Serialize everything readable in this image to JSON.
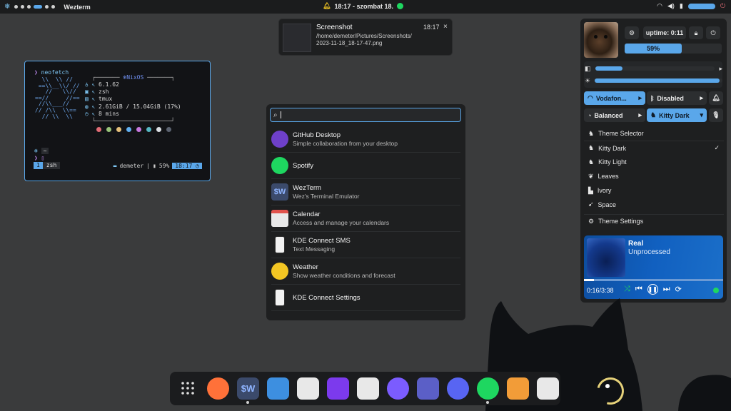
{
  "topbar": {
    "title": "Wezterm",
    "clock": "18:17 - szombat 18.",
    "icons": [
      "nix-icon",
      "bell-icon",
      "spotify-icon",
      "wifi-icon",
      "volume-icon",
      "battery-icon",
      "power-icon"
    ]
  },
  "notification": {
    "title": "Screenshot",
    "time": "18:17",
    "path_line1": "/home/demeter/Pictures/Screenshots/",
    "path_line2": "2023-11-18_18-17-47.png",
    "close": "×"
  },
  "terminal": {
    "command": "neofetch",
    "prompt_symbol": "❯",
    "os": "NixOS",
    "kernel": "6.1.62",
    "shell": "zsh",
    "multiplexer": "tmux",
    "memory": "2.61GiB / 15.04GiB (17%)",
    "uptime": "8 mins",
    "cwd": "~",
    "tab_number": "1",
    "tab_name": "zsh",
    "status_user": "demeter",
    "status_battery": "59%",
    "status_time": "18:17",
    "palette": [
      "#e06c75",
      "#98c379",
      "#e5c07b",
      "#61afef",
      "#c678dd",
      "#56b6c2",
      "#dcdfe4",
      "#5c6370"
    ]
  },
  "launcher": {
    "search_value": "",
    "results": [
      {
        "name": "GitHub Desktop",
        "desc": "Simple collaboration from your desktop",
        "icon": "github-icon",
        "color": "#6e40c9"
      },
      {
        "name": "Spotify",
        "desc": "",
        "icon": "spotify-icon",
        "color": "#1ed760"
      },
      {
        "name": "WezTerm",
        "desc": "Wez's Terminal Emulator",
        "icon": "wezterm-icon",
        "color": "#3b4a6b"
      },
      {
        "name": "Calendar",
        "desc": "Access and manage your calendars",
        "icon": "calendar-icon",
        "color": "#e8e8e8"
      },
      {
        "name": "KDE Connect SMS",
        "desc": "Text Messaging",
        "icon": "kdeconnect-icon",
        "color": "#f2f2f2"
      },
      {
        "name": "Weather",
        "desc": "Show weather conditions and forecast",
        "icon": "weather-icon",
        "color": "#f3c623"
      },
      {
        "name": "KDE Connect Settings",
        "desc": "",
        "icon": "kdeconnect-icon",
        "color": "#f2f2f2"
      }
    ]
  },
  "panel": {
    "uptime": "uptime: 0:11",
    "battery_percent": "59%",
    "battery_level": 0.59,
    "volume_level": 0.23,
    "brightness_level": 0.98,
    "wifi": "Vodafon...",
    "bluetooth": "Disabled",
    "power_profile": "Balanced",
    "theme": "Kitty Dark",
    "menu_header": "Theme Selector",
    "themes": [
      "Kitty Dark",
      "Kitty Light",
      "Leaves",
      "Ivory",
      "Space"
    ],
    "selected_check": "✓",
    "menu_footer": "Theme Settings"
  },
  "player": {
    "track": "Real",
    "artist": "Unprocessed",
    "time": "0:16/3:38",
    "progress": 0.073
  },
  "dock": {
    "apps": [
      {
        "icon": "app-grid-icon",
        "label": "",
        "color": "#1b1c1e",
        "running": false
      },
      {
        "icon": "firefox-icon",
        "label": "",
        "color": "#ff7139",
        "running": false
      },
      {
        "icon": "wezterm-icon",
        "label": "$W",
        "color": "#3b4a6b",
        "running": true
      },
      {
        "icon": "files-icon",
        "label": "",
        "color": "#3d8fe0",
        "running": false
      },
      {
        "icon": "calendar-icon",
        "label": "",
        "color": "#e8e8e8",
        "running": false
      },
      {
        "icon": "obsidian-icon",
        "label": "",
        "color": "#7c3aed",
        "running": false
      },
      {
        "icon": "downloader-icon",
        "label": "",
        "color": "#e8e8e8",
        "running": false
      },
      {
        "icon": "messenger-icon",
        "label": "",
        "color": "#7b5cff",
        "running": false
      },
      {
        "icon": "teams-icon",
        "label": "",
        "color": "#5b5fc7",
        "running": false
      },
      {
        "icon": "discord-icon",
        "label": "",
        "color": "#5865f2",
        "running": false
      },
      {
        "icon": "spotify-icon",
        "label": "",
        "color": "#1ed760",
        "running": true
      },
      {
        "icon": "paint-icon",
        "label": "",
        "color": "#f29c38",
        "running": false
      },
      {
        "icon": "store-icon",
        "label": "",
        "color": "#e8e8e8",
        "running": false
      }
    ]
  }
}
